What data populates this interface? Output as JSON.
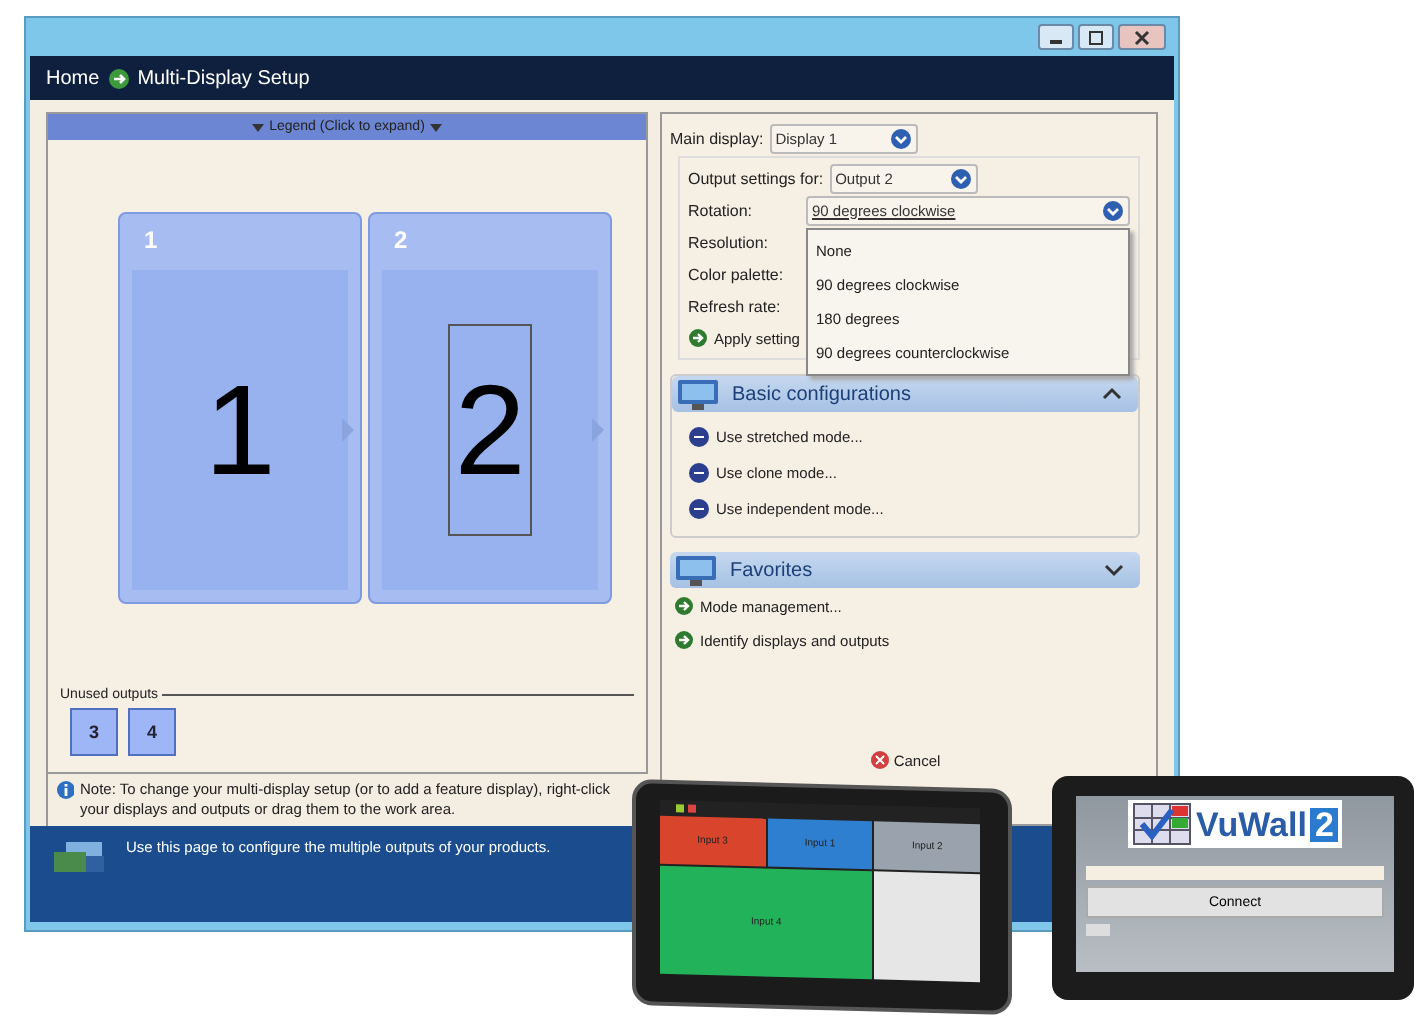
{
  "window": {
    "breadcrumb": [
      "Home",
      "Multi-Display Setup"
    ]
  },
  "legend": {
    "label": "Legend (Click to expand)"
  },
  "displays": [
    {
      "tab": "1",
      "number": "1",
      "rotated": false
    },
    {
      "tab": "2",
      "number": "2",
      "rotated": true
    }
  ],
  "unused_outputs": {
    "label": "Unused outputs",
    "items": [
      "3",
      "4"
    ]
  },
  "note": "Note: To change your multi-display setup (or to add a feature display), right-click your displays and outputs or drag them to the work area.",
  "settings": {
    "main_display": {
      "label": "Main display:",
      "value": "Display 1"
    },
    "output_for": {
      "label": "Output settings for:",
      "value": "Output 2"
    },
    "rotation": {
      "label": "Rotation:",
      "value": "90 degrees clockwise",
      "options": [
        "None",
        "90 degrees clockwise",
        "180 degrees",
        "90 degrees counterclockwise"
      ]
    },
    "fields": [
      "Resolution:",
      "Color palette:",
      "Refresh rate:"
    ],
    "apply": "Apply setting"
  },
  "sections": [
    {
      "title": "Basic configurations",
      "expanded": true,
      "links": [
        "Use stretched mode...",
        "Use clone mode...",
        "Use independent mode..."
      ]
    },
    {
      "title": "Favorites",
      "expanded": false
    }
  ],
  "tasks": [
    "Mode management...",
    "Identify displays and outputs"
  ],
  "cancel": "Cancel",
  "footer": "Use this page to configure the multiple outputs of your products.",
  "tablet_wall": [
    {
      "label": "Input 3",
      "color": "#d9442c"
    },
    {
      "label": "Input 1",
      "color": "#2f7fd0"
    },
    {
      "label": "Input 2",
      "color": "#9aa3ad"
    },
    {
      "label": "Input 4",
      "color": "#22b35a"
    }
  ],
  "tablet_login": {
    "logo": "VuWall",
    "logo_number": "2",
    "button": "Connect"
  }
}
